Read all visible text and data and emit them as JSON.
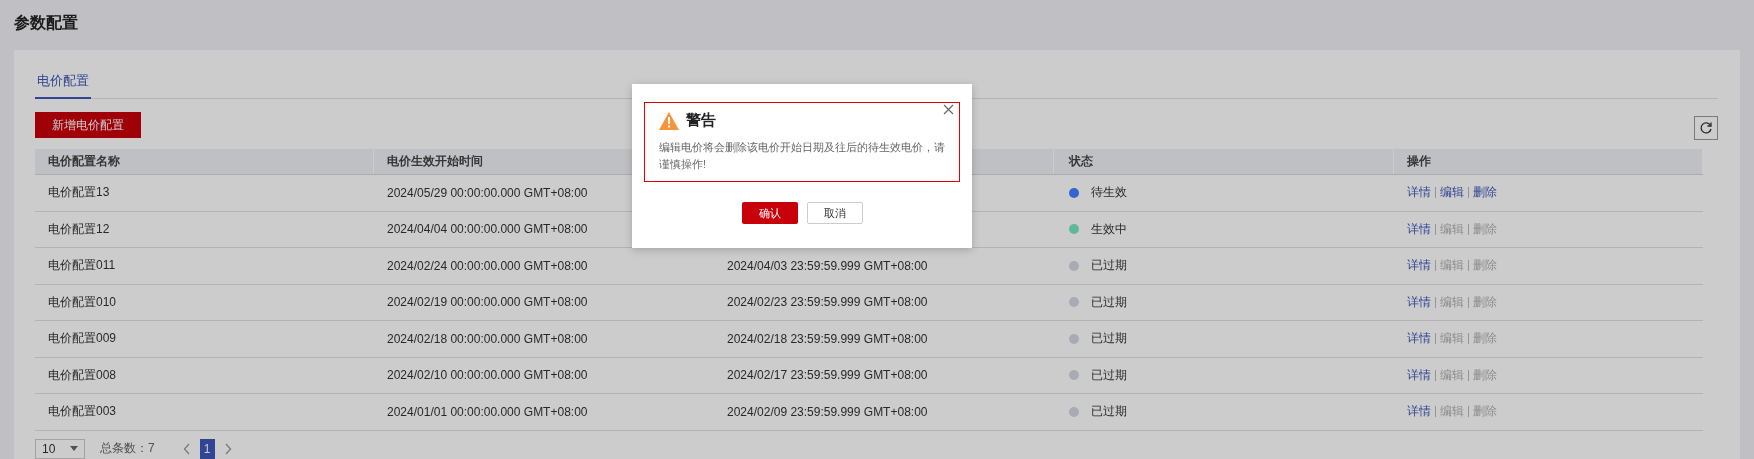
{
  "page_title": "参数配置",
  "tabs": [
    {
      "label": "电价配置",
      "selected": true
    }
  ],
  "add_button": "新增电价配置",
  "table": {
    "columns": [
      "电价配置名称",
      "电价生效开始时间",
      "状态",
      "操作"
    ],
    "rows": [
      {
        "name": "电价配置13",
        "start": "2024/05/29 00:00:00.000 GMT+08:00",
        "status": "待生效",
        "color": "#3366cc",
        "actions": [
          {
            "label": "详情",
            "disabled": false
          },
          {
            "label": "编辑",
            "disabled": false
          },
          {
            "label": "删除",
            "disabled": false
          }
        ]
      },
      {
        "name": "电价配置12",
        "start": "2024/04/04 00:00:00.000 GMT+08:00",
        "status": "生效中",
        "color": "#5fb89a",
        "actions": [
          {
            "label": "详情",
            "disabled": false
          },
          {
            "label": "编辑",
            "disabled": true
          },
          {
            "label": "删除",
            "disabled": true
          }
        ]
      },
      {
        "name": "电价配置011",
        "start": "2024/02/24 00:00:00.000 GMT+08:00",
        "end": "2024/04/03 23:59:59.999 GMT+08:00",
        "status": "已过期",
        "color": "#a8abb3",
        "actions": [
          {
            "label": "详情",
            "disabled": false
          },
          {
            "label": "编辑",
            "disabled": true
          },
          {
            "label": "删除",
            "disabled": true
          }
        ]
      },
      {
        "name": "电价配置010",
        "start": "2024/02/19 00:00:00.000 GMT+08:00",
        "end": "2024/02/23 23:59:59.999 GMT+08:00",
        "status": "已过期",
        "color": "#a8abb3",
        "actions": [
          {
            "label": "详情",
            "disabled": false
          },
          {
            "label": "编辑",
            "disabled": true
          },
          {
            "label": "删除",
            "disabled": true
          }
        ]
      },
      {
        "name": "电价配置009",
        "start": "2024/02/18 00:00:00.000 GMT+08:00",
        "end": "2024/02/18 23:59:59.999 GMT+08:00",
        "status": "已过期",
        "color": "#a8abb3",
        "actions": [
          {
            "label": "详情",
            "disabled": false
          },
          {
            "label": "编辑",
            "disabled": true
          },
          {
            "label": "删除",
            "disabled": true
          }
        ]
      },
      {
        "name": "电价配置008",
        "start": "2024/02/10 00:00:00.000 GMT+08:00",
        "end": "2024/02/17 23:59:59.999 GMT+08:00",
        "status": "已过期",
        "color": "#a8abb3",
        "actions": [
          {
            "label": "详情",
            "disabled": false
          },
          {
            "label": "编辑",
            "disabled": true
          },
          {
            "label": "删除",
            "disabled": true
          }
        ]
      },
      {
        "name": "电价配置003",
        "start": "2024/01/01 00:00:00.000 GMT+08:00",
        "end": "2024/02/09 23:59:59.999 GMT+08:00",
        "status": "已过期",
        "color": "#a8abb3",
        "actions": [
          {
            "label": "详情",
            "disabled": false
          },
          {
            "label": "编辑",
            "disabled": true
          },
          {
            "label": "删除",
            "disabled": true
          }
        ]
      }
    ]
  },
  "pagination": {
    "page_size": "10",
    "total": "总条数：7",
    "pages": [
      {
        "label": "1",
        "selected": true
      }
    ]
  },
  "dialog": {
    "title": "警告",
    "message": "编辑电价将会删除该电价开始日期及往后的待生效电价，请谨慎操作!",
    "confirm": "确认",
    "cancel": "取消"
  }
}
